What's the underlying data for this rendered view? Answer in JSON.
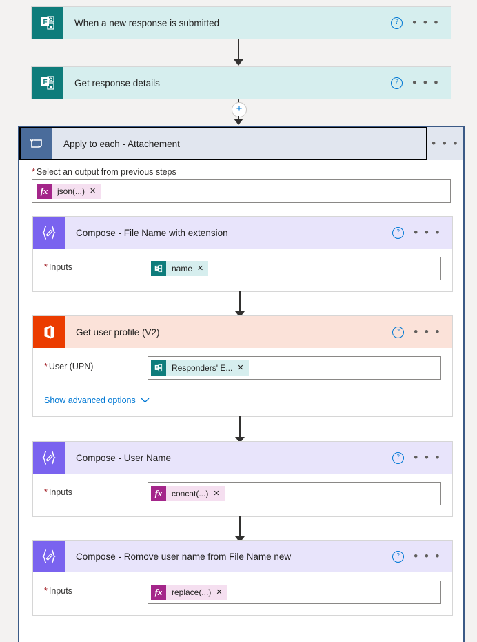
{
  "flow": {
    "nodes": [
      {
        "id": "trigger-forms",
        "title": "When a new response is submitted",
        "icon": "microsoft-forms-icon",
        "header_bg": "#d6eeee",
        "icon_bg": "#0e7c7b",
        "help_label": "?",
        "more_label": "• • •"
      },
      {
        "id": "get-response-details",
        "title": "Get response details",
        "icon": "microsoft-forms-icon",
        "header_bg": "#d6eeee",
        "icon_bg": "#0e7c7b",
        "help_label": "?",
        "more_label": "• • •"
      }
    ],
    "add_step_label": "+",
    "scope": {
      "title": "Apply to each - Attachement",
      "icon": "loop-icon",
      "icon_bg": "#4a6c9b",
      "header_bg": "#e1e6ef",
      "more_label": "• • •",
      "field_label": "Select an output from previous steps",
      "required_marker": "*",
      "token": {
        "badge": "fx",
        "text": "json(...)",
        "remove": "✕"
      },
      "children": [
        {
          "id": "compose-file-name-with-extension",
          "title": "Compose - File Name with extension",
          "icon": "compose-icon",
          "header_bg": "#e8e4fb",
          "icon_bg": "#7a63ef",
          "help_label": "?",
          "more_label": "• • •",
          "field_label": "Inputs",
          "required_marker": "*",
          "token": {
            "badge": "microsoft-forms-icon",
            "text": "name",
            "remove": "✕",
            "kind": "forms"
          }
        },
        {
          "id": "get-user-profile-v2",
          "title": "Get user profile (V2)",
          "icon": "office-365-icon",
          "header_bg": "#fbe2d9",
          "icon_bg": "#eb3c00",
          "help_label": "?",
          "more_label": "• • •",
          "field_label": "User (UPN)",
          "required_marker": "*",
          "token": {
            "badge": "microsoft-forms-icon",
            "text": "Responders' E...",
            "remove": "✕",
            "kind": "forms"
          },
          "advanced_options_label": "Show advanced options",
          "advanced_chevron": "⌄"
        },
        {
          "id": "compose-user-name",
          "title": "Compose - User Name",
          "icon": "compose-icon",
          "header_bg": "#e8e4fb",
          "icon_bg": "#7a63ef",
          "help_label": "?",
          "more_label": "• • •",
          "field_label": "Inputs",
          "required_marker": "*",
          "token": {
            "badge": "fx",
            "text": "concat(...)",
            "remove": "✕",
            "kind": "fx"
          }
        },
        {
          "id": "compose-remove-user-name",
          "title": "Compose - Romove user name from File Name new",
          "icon": "compose-icon",
          "header_bg": "#e8e4fb",
          "icon_bg": "#7a63ef",
          "help_label": "?",
          "more_label": "• • •",
          "field_label": "Inputs",
          "required_marker": "*",
          "token": {
            "badge": "fx",
            "text": "replace(...)",
            "remove": "✕",
            "kind": "fx"
          }
        }
      ]
    }
  },
  "colors": {
    "canvas": "#f3f2f1",
    "forms_teal": "#0e7c7b",
    "compose_purple": "#7a63ef",
    "office_orange": "#eb3c00",
    "loop_blue": "#4a6c9b",
    "fx_magenta": "#a4268a",
    "link_blue": "#0078d4",
    "required_red": "#a4262c"
  }
}
